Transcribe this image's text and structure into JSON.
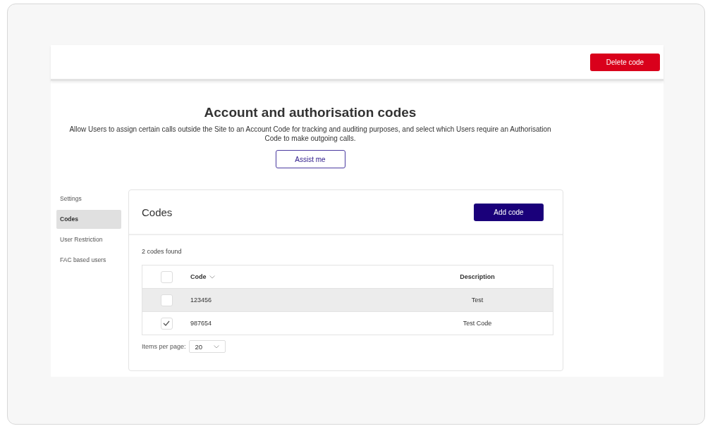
{
  "header": {
    "delete_button": "Delete code"
  },
  "intro": {
    "title": "Account and authorisation codes",
    "description": "Allow Users to assign certain calls outside the Site to an Account Code for tracking and auditing purposes, and select which Users require an Authorisation Code to make outgoing calls.",
    "assist_button": "Assist me"
  },
  "sidebar": {
    "items": [
      {
        "label": "Settings",
        "selected": false
      },
      {
        "label": "Codes",
        "selected": true
      },
      {
        "label": "User Restriction",
        "selected": false
      },
      {
        "label": "FAC based users",
        "selected": false
      }
    ]
  },
  "card": {
    "title": "Codes",
    "add_button": "Add code",
    "count": "2 codes found",
    "table": {
      "select_all_checked": false,
      "columns": [
        {
          "label": "Code",
          "sortable": true
        },
        {
          "label": "Description",
          "sortable": false
        }
      ],
      "rows": [
        {
          "code": "123456",
          "description": "Test",
          "checked": false,
          "highlighted": true
        },
        {
          "code": "987654",
          "description": "Test Code",
          "checked": true,
          "highlighted": false
        }
      ]
    },
    "pagination": {
      "label": "Items per page:",
      "value": "20"
    }
  }
}
